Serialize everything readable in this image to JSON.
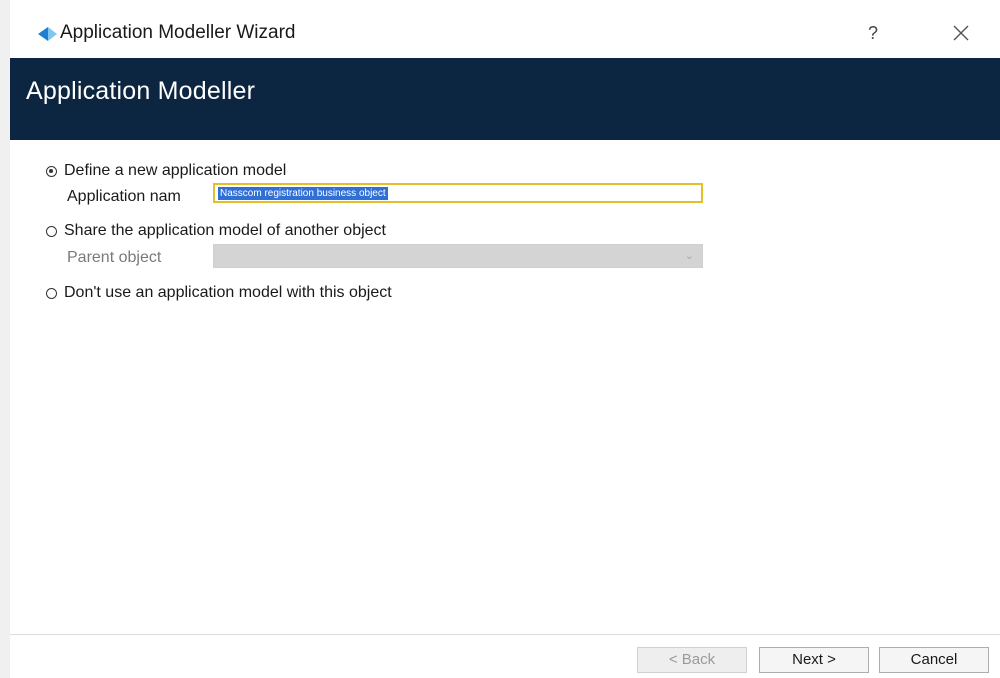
{
  "window": {
    "title": "Application Modeller Wizard",
    "help_label": "?",
    "icon": "blue-prism-app-icon",
    "close_icon": "close-icon"
  },
  "banner": {
    "title": "Application Modeller"
  },
  "options": {
    "define_new": {
      "label": "Define a new application model",
      "selected": true,
      "app_name_label": "Application nam",
      "app_name_value": "Nasscom registration business object"
    },
    "share_model": {
      "label": "Share the application model of another object",
      "selected": false,
      "parent_label": "Parent object",
      "parent_value": "",
      "parent_disabled": true
    },
    "no_model": {
      "label": "Don't use an application model with this object",
      "selected": false
    }
  },
  "footer": {
    "back_label": "< Back",
    "back_disabled": true,
    "next_label": "Next >",
    "cancel_label": "Cancel"
  },
  "colors": {
    "banner_bg": "#0c2541",
    "input_focus_border": "#e2bf2c",
    "selection_bg": "#2f6fd6"
  }
}
